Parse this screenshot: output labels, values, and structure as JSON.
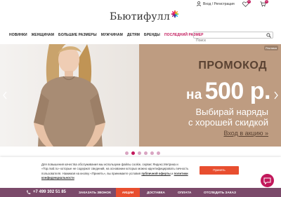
{
  "header": {
    "login_label": "Вход / Регистрация",
    "favorites_count": "0",
    "cart_count": "0"
  },
  "logo": {
    "text": "Бьютифулл"
  },
  "nav": {
    "items": [
      "НОВИНКИ",
      "ЖЕНЩИНАМ",
      "БОЛЬШИЕ РАЗМЕРЫ",
      "МУЖЧИНАМ",
      "ДЕТЯМ",
      "БРЕНДЫ",
      "ПОСЛЕДНИЙ РАЗМЕР"
    ]
  },
  "search": {
    "placeholder": "Поиск"
  },
  "banner": {
    "tag": "Реклама",
    "title": "ПРОМОКОД",
    "prefix": "на",
    "amount": "500 р.",
    "line1": "Выбирай наряды",
    "line2": "с хорошей скидкой",
    "link": "Вход в акцию »"
  },
  "slider": {
    "total": 6,
    "active": 1
  },
  "cookie": {
    "text_part1": "Для повышения качества обслуживания мы используем файлы cookie, сервис Яндекс.Метрика и «Top.mail.ru» которые не содержат сведений, на основании которых можно идентифицировать личность пользователя. Нажимая на кнопку «Принять», вы принимаете условия ",
    "link1": "публичной оферты",
    "text_part2": " и ",
    "link2": "политики конфиденциальности",
    "accept_label": "Принять"
  },
  "bottom_bar": {
    "phone": "+7 499 302 51 85",
    "callback": "ЗАКАЗАТЬ ЗВОНОК",
    "promo": "АКЦИИ",
    "delivery": "ДОСТАВКА",
    "payment": "ОПЛАТА",
    "returns": "ОТСЛЕДИТЬ ЗАКАЗ"
  },
  "colors": {
    "accent": "#c2185b",
    "promo_bg": "#be9c81",
    "bottom_bar": "#7b4a6a",
    "cta": "#e84e2f"
  }
}
